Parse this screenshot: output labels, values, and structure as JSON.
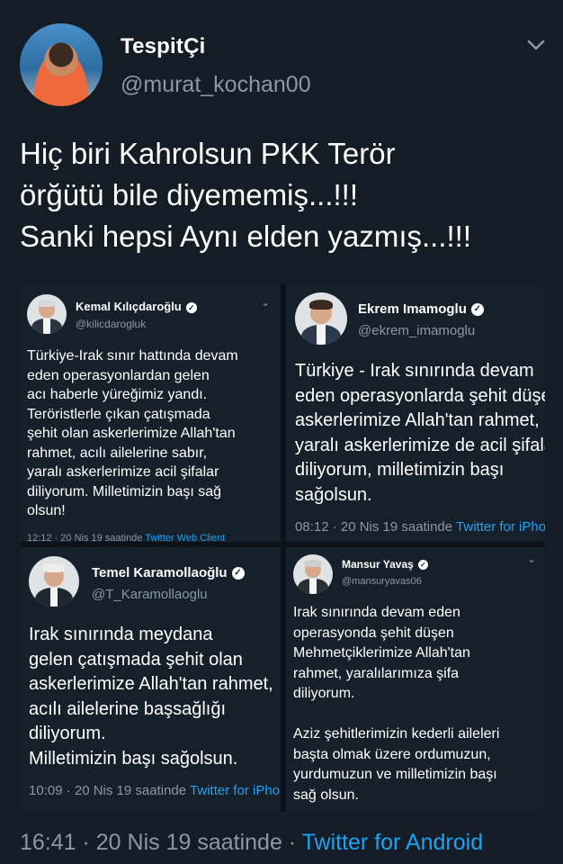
{
  "tweet": {
    "author_name": "TespitÇi",
    "author_handle": "@murat_kochan00",
    "text": "Hiç biri Kahrolsun PKK Terör\nörğütü bile diyememiş...!!!\nSanki hepsi Aynı elden yazmış...!!!",
    "timestamp": "16:41 · 20 Nis 19 saatinde",
    "separator": " · ",
    "source": "Twitter for Android"
  },
  "cards": [
    {
      "name": "Kemal Kılıçdaroğlu",
      "handle": "@kilicdarogluk",
      "text": "Türkiye-Irak sınır hattında devam\neden operasyonlardan gelen\nacı haberle yüreğimiz yandı.\nTeröristlerle çıkan çatışmada\nşehit olan askerlerimize Allah'tan\nrahmet, acılı ailelerine sabır,\nyaralı askerlerimize acil şifalar\ndiliyorum. Milletimizin başı sağ\nolsun!",
      "time": "12:12 · 20 Nis 19 saatinde",
      "source": "Twitter Web Client"
    },
    {
      "name": "Ekrem Imamoglu",
      "handle": "@ekrem_imamoglu",
      "text": "Türkiye - Irak sınırında devam\neden operasyonlarda şehit düşen\naskerlerimize Allah'tan rahmet,\nyaralı askerlerimize de acil şifalar\ndiliyorum, milletimizin başı\nsağolsun.",
      "time": "08:12 · 20 Nis 19 saatinde",
      "source": "Twitter for iPhone"
    },
    {
      "name": "Temel Karamollaoğlu",
      "handle": "@T_Karamollaoglu",
      "text": "Irak sınırında meydana\ngelen çatışmada şehit olan\naskerlerimize Allah'tan rahmet,\nacılı ailelerine başsağlığı\ndiliyorum.\nMilletimizin başı sağolsun.",
      "time": "10:09 · 20 Nis 19 saatinde",
      "source": "Twitter for iPhone"
    },
    {
      "name": "Mansur Yavaş",
      "handle": "@mansuryavas06",
      "text": "Irak sınırında devam eden\noperasyonda şehit düşen\nMehmetçiklerimize Allah'tan\nrahmet, yaralılarımıza şifa\ndiliyorum.\n\nAziz şehitlerimizin kederli aileleri\nbaşta olmak üzere ordumuzun,\nyurdumuzun ve milletimizin başı\nsağ olsun.",
      "time": "",
      "source": ""
    }
  ],
  "icons": {
    "chevron": "chevron-down-icon",
    "verified": "verified-badge-icon"
  },
  "colors": {
    "background": "#141d26",
    "card_background": "#15202b",
    "secondary_text": "#8899a6",
    "link": "#1da1f2"
  }
}
